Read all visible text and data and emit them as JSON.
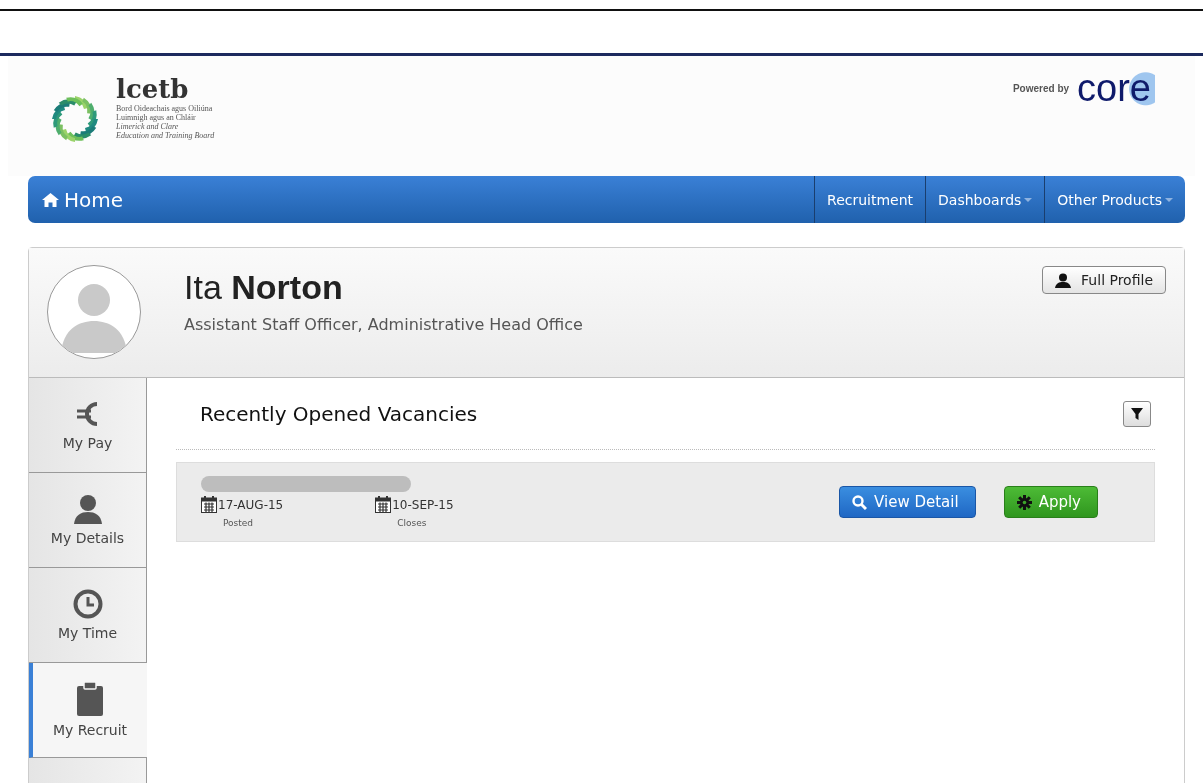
{
  "logo": {
    "name": "lcetb",
    "lines": [
      "Bord Oideachais agus Oiliúna",
      "Luimnigh agus an Chláir",
      "Limerick and Clare",
      "Education and Training Board"
    ]
  },
  "powered": {
    "label": "Powered by",
    "brand": "core"
  },
  "navbar": {
    "home": "Home",
    "items": [
      {
        "label": "Recruitment",
        "dropdown": false
      },
      {
        "label": "Dashboards",
        "dropdown": true
      },
      {
        "label": "Other Products",
        "dropdown": true
      }
    ]
  },
  "profile": {
    "first_name": "Ita",
    "last_name": "Norton",
    "role": "Assistant Staff Officer, Administrative Head Office",
    "button": "Full Profile"
  },
  "sidebar": [
    {
      "label": "My Pay",
      "selected": false
    },
    {
      "label": "My Details",
      "selected": false
    },
    {
      "label": "My Time",
      "selected": false
    },
    {
      "label": "My Recruit",
      "selected": true
    }
  ],
  "section": {
    "title": "Recently Opened Vacancies"
  },
  "vacancies": [
    {
      "posted": "17-AUG-15",
      "posted_label": "Posted",
      "closes": "10-SEP-15",
      "closes_label": "Closes",
      "view": "View Detail",
      "apply": "Apply"
    }
  ]
}
